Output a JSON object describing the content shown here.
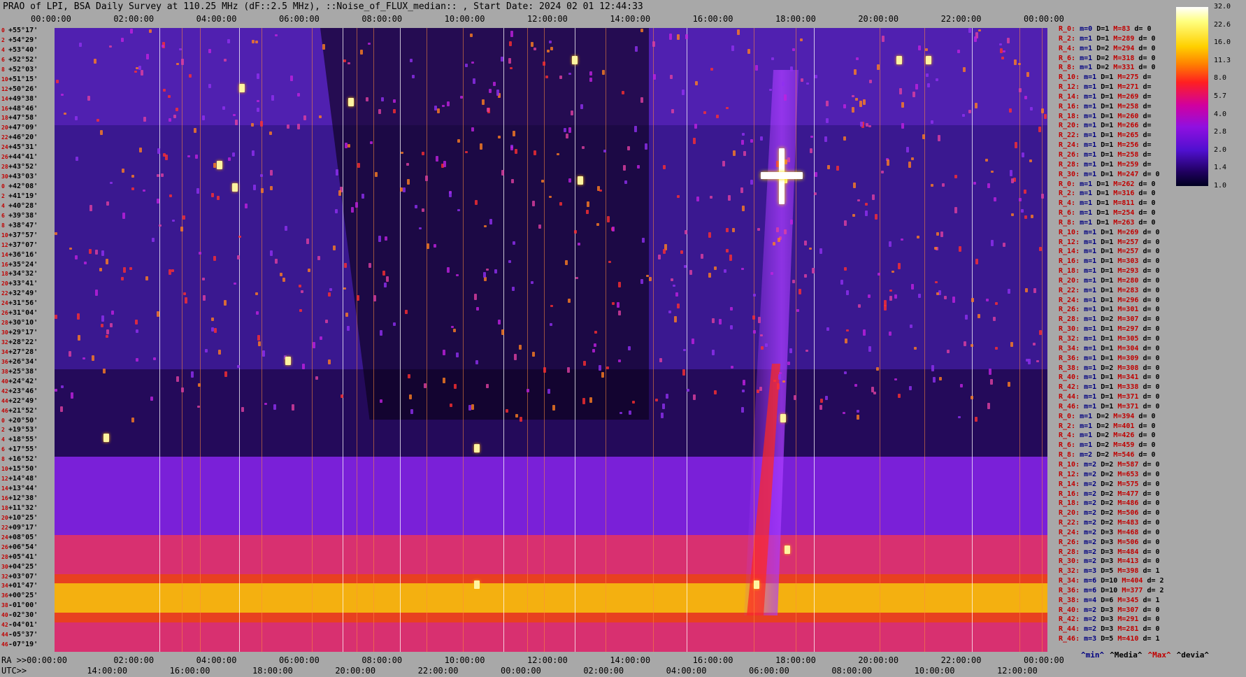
{
  "title": "PRAO of LPI, BSA Daily Survey at 110.25 MHz (dF::2.5 MHz), ::Noise_of_FLUX_median:: , Start Date: 2024 02 01 12:44:33",
  "top_ticks": [
    "00:00:00",
    "02:00:00",
    "04:00:00",
    "06:00:00",
    "08:00:00",
    "10:00:00",
    "12:00:00",
    "14:00:00",
    "16:00:00",
    "18:00:00",
    "20:00:00",
    "22:00:00",
    "00:00:00"
  ],
  "ra_label": "RA >>00:00:00",
  "ra_ticks": [
    "02:00:00",
    "04:00:00",
    "06:00:00",
    "08:00:00",
    "10:00:00",
    "12:00:00",
    "14:00:00",
    "16:00:00",
    "18:00:00",
    "20:00:00",
    "22:00:00",
    "00:00:00"
  ],
  "utc_label": "UTC>>",
  "utc_ticks": [
    "14:00:00",
    "16:00:00",
    "18:00:00",
    "20:00:00",
    "22:00:00",
    "00:00:00",
    "02:00:00",
    "04:00:00",
    "06:00:00",
    "08:00:00",
    "10:00:00",
    "12:00:00"
  ],
  "declinations": [
    "+55°17'",
    "+54°29'",
    "+53°40'",
    "+52°52'",
    "+52°03'",
    "+51°15'",
    "+50°26'",
    "+49°38'",
    "+48°46'",
    "+47°58'",
    "+47°09'",
    "+46°20'",
    "+45°31'",
    "+44°41'",
    "+43°52'",
    "+43°03'",
    "+42°08'",
    "+41°19'",
    "+40°28'",
    "+39°38'",
    "+38°47'",
    "+37°57'",
    "+37°07'",
    "+36°16'",
    "+35°24'",
    "+34°32'",
    "+33°41'",
    "+32°49'",
    "+31°56'",
    "+31°04'",
    "+30°10'",
    "+29°17'",
    "+28°22'",
    "+27°28'",
    "+26°34'",
    "+25°38'",
    "+24°42'",
    "+23°46'",
    "+22°49'",
    "+21°52'",
    "+20°50'",
    "+19°53'",
    "+18°55'",
    "+17°55'",
    "+16°52'",
    "+15°50'",
    "+14°48'",
    "+13°44'",
    "+12°38'",
    "+11°32'",
    "+10°25'",
    "+09°17'",
    "+08°05'",
    "+06°54'",
    "+05°41'",
    "+04°25'",
    "+03°07'",
    "+01°47'",
    "+00°25'",
    "-01°00'",
    "-02°30'",
    "-04°01'",
    "-05°37'",
    "-07°19'"
  ],
  "decl_index": [
    "0",
    "2",
    "4",
    "6",
    "8",
    "10",
    "12",
    "14",
    "16",
    "18",
    "20",
    "22",
    "24",
    "26",
    "28",
    "30",
    "0",
    "2",
    "4",
    "6",
    "8",
    "10",
    "12",
    "14",
    "16",
    "18",
    "20",
    "22",
    "24",
    "26",
    "28",
    "30",
    "32",
    "34",
    "36",
    "38",
    "40",
    "42",
    "44",
    "46",
    "0",
    "2",
    "4",
    "6",
    "8",
    "10",
    "12",
    "14",
    "16",
    "18",
    "20",
    "22",
    "24",
    "26",
    "28",
    "30",
    "32",
    "34",
    "36",
    "38",
    "40",
    "42",
    "44",
    "46"
  ],
  "ray_stats": [
    [
      "R_0:",
      "m=0",
      "D=1",
      "M=83",
      "d= 0"
    ],
    [
      "R_2:",
      "m=1",
      "D=1",
      "M=289",
      "d= 0"
    ],
    [
      "R_4:",
      "m=1",
      "D=2",
      "M=294",
      "d= 0"
    ],
    [
      "R_6:",
      "m=1",
      "D=2",
      "M=318",
      "d= 0"
    ],
    [
      "R_8:",
      "m=1",
      "D=2",
      "M=331",
      "d= 0"
    ],
    [
      "R_10:",
      "m=1",
      "D=1",
      "M=275",
      "d="
    ],
    [
      "R_12:",
      "m=1",
      "D=1",
      "M=271",
      "d="
    ],
    [
      "R_14:",
      "m=1",
      "D=1",
      "M=269",
      "d="
    ],
    [
      "R_16:",
      "m=1",
      "D=1",
      "M=258",
      "d="
    ],
    [
      "R_18:",
      "m=1",
      "D=1",
      "M=260",
      "d="
    ],
    [
      "R_20:",
      "m=1",
      "D=1",
      "M=266",
      "d="
    ],
    [
      "R_22:",
      "m=1",
      "D=1",
      "M=265",
      "d="
    ],
    [
      "R_24:",
      "m=1",
      "D=1",
      "M=256",
      "d="
    ],
    [
      "R_26:",
      "m=1",
      "D=1",
      "M=258",
      "d="
    ],
    [
      "R_28:",
      "m=1",
      "D=1",
      "M=259",
      "d="
    ],
    [
      "R_30:",
      "m=1",
      "D=1",
      "M=247",
      "d= 0"
    ],
    [
      "R_0:",
      "m=1",
      "D=1",
      "M=262",
      "d= 0"
    ],
    [
      "R_2:",
      "m=1",
      "D=1",
      "M=316",
      "d= 0"
    ],
    [
      "R_4:",
      "m=1",
      "D=1",
      "M=811",
      "d= 0"
    ],
    [
      "R_6:",
      "m=1",
      "D=1",
      "M=254",
      "d= 0"
    ],
    [
      "R_8:",
      "m=1",
      "D=1",
      "M=263",
      "d= 0"
    ],
    [
      "R_10:",
      "m=1",
      "D=1",
      "M=269",
      "d= 0"
    ],
    [
      "R_12:",
      "m=1",
      "D=1",
      "M=257",
      "d= 0"
    ],
    [
      "R_14:",
      "m=1",
      "D=1",
      "M=257",
      "d= 0"
    ],
    [
      "R_16:",
      "m=1",
      "D=1",
      "M=303",
      "d= 0"
    ],
    [
      "R_18:",
      "m=1",
      "D=1",
      "M=293",
      "d= 0"
    ],
    [
      "R_20:",
      "m=1",
      "D=1",
      "M=280",
      "d= 0"
    ],
    [
      "R_22:",
      "m=1",
      "D=1",
      "M=283",
      "d= 0"
    ],
    [
      "R_24:",
      "m=1",
      "D=1",
      "M=296",
      "d= 0"
    ],
    [
      "R_26:",
      "m=1",
      "D=1",
      "M=301",
      "d= 0"
    ],
    [
      "R_28:",
      "m=1",
      "D=2",
      "M=307",
      "d= 0"
    ],
    [
      "R_30:",
      "m=1",
      "D=1",
      "M=297",
      "d= 0"
    ],
    [
      "R_32:",
      "m=1",
      "D=1",
      "M=305",
      "d= 0"
    ],
    [
      "R_34:",
      "m=1",
      "D=1",
      "M=304",
      "d= 0"
    ],
    [
      "R_36:",
      "m=1",
      "D=1",
      "M=309",
      "d= 0"
    ],
    [
      "R_38:",
      "m=1",
      "D=2",
      "M=308",
      "d= 0"
    ],
    [
      "R_40:",
      "m=1",
      "D=1",
      "M=341",
      "d= 0"
    ],
    [
      "R_42:",
      "m=1",
      "D=1",
      "M=338",
      "d= 0"
    ],
    [
      "R_44:",
      "m=1",
      "D=1",
      "M=371",
      "d= 0"
    ],
    [
      "R_46:",
      "m=1",
      "D=1",
      "M=371",
      "d= 0"
    ],
    [
      "R_0:",
      "m=1",
      "D=2",
      "M=394",
      "d= 0"
    ],
    [
      "R_2:",
      "m=1",
      "D=2",
      "M=401",
      "d= 0"
    ],
    [
      "R_4:",
      "m=1",
      "D=2",
      "M=426",
      "d= 0"
    ],
    [
      "R_6:",
      "m=1",
      "D=2",
      "M=459",
      "d= 0"
    ],
    [
      "R_8:",
      "m=2",
      "D=2",
      "M=546",
      "d= 0"
    ],
    [
      "R_10:",
      "m=2",
      "D=2",
      "M=587",
      "d= 0"
    ],
    [
      "R_12:",
      "m=2",
      "D=2",
      "M=653",
      "d= 0"
    ],
    [
      "R_14:",
      "m=2",
      "D=2",
      "M=575",
      "d= 0"
    ],
    [
      "R_16:",
      "m=2",
      "D=2",
      "M=477",
      "d= 0"
    ],
    [
      "R_18:",
      "m=2",
      "D=2",
      "M=486",
      "d= 0"
    ],
    [
      "R_20:",
      "m=2",
      "D=2",
      "M=506",
      "d= 0"
    ],
    [
      "R_22:",
      "m=2",
      "D=2",
      "M=483",
      "d= 0"
    ],
    [
      "R_24:",
      "m=2",
      "D=3",
      "M=468",
      "d= 0"
    ],
    [
      "R_26:",
      "m=2",
      "D=3",
      "M=506",
      "d= 0"
    ],
    [
      "R_28:",
      "m=2",
      "D=3",
      "M=484",
      "d= 0"
    ],
    [
      "R_30:",
      "m=2",
      "D=3",
      "M=413",
      "d= 0"
    ],
    [
      "R_32:",
      "m=3",
      "D=5",
      "M=398",
      "d= 1"
    ],
    [
      "R_34:",
      "m=6",
      "D=10",
      "M=404",
      "d= 2"
    ],
    [
      "R_36:",
      "m=6",
      "D=10",
      "M=377",
      "d= 2"
    ],
    [
      "R_38:",
      "m=4",
      "D=6",
      "M=345",
      "d= 1"
    ],
    [
      "R_40:",
      "m=2",
      "D=3",
      "M=307",
      "d= 0"
    ],
    [
      "R_42:",
      "m=2",
      "D=3",
      "M=291",
      "d= 0"
    ],
    [
      "R_44:",
      "m=2",
      "D=3",
      "M=281",
      "d= 0"
    ],
    [
      "R_46:",
      "m=3",
      "D=5",
      "M=410",
      "d= 1"
    ]
  ],
  "legend": [
    "^min^",
    "^Media^",
    "^Max^",
    "^devia^"
  ],
  "colorbar_ticks": [
    "32.0",
    "22.6",
    "16.0",
    "11.3",
    "8.0",
    "5.7",
    "4.0",
    "2.8",
    "2.0",
    "1.4",
    "1.0"
  ],
  "chart_data": {
    "type": "heatmap",
    "title": "PRAO of LPI, BSA Daily Survey at 110.25 MHz (dF::2.5 MHz), ::Noise_of_FLUX_median:: , Start Date: 2024 02 01 12:44:33",
    "x_axis": "RA / UTC time, 24 hours",
    "y_axis": "Declination (+55°17' to -07°19'), 64 beams",
    "colorscale_range": [
      1.0,
      32.0
    ],
    "colorscale": "log, dark blue -> purple -> red -> yellow -> white",
    "notable_features": [
      "bright horizontal band near +01°47' to -01°00'",
      "bright diagonal source near 19:00-20:00 RA",
      "point source near 20:00 RA, +41°19'"
    ]
  },
  "colors": {
    "background": "#a8a8a8",
    "label_red": "#c00000",
    "label_blue": "#000080"
  }
}
